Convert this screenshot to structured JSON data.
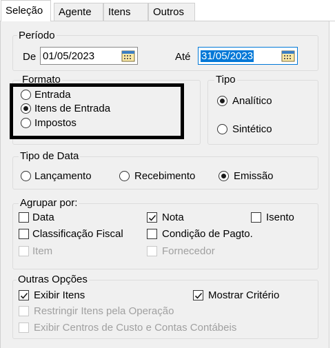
{
  "tabs": [
    "Seleção",
    "Agente",
    "Itens",
    "Outros"
  ],
  "periodo": {
    "legend": "Período",
    "de_label": "De",
    "de_value": "01/05/2023",
    "ate_label": "Até",
    "ate_value": "31/05/2023"
  },
  "formato": {
    "legend": "Formato",
    "options": [
      "Entrada",
      "Itens de Entrada",
      "Impostos"
    ],
    "selected": "Itens de Entrada"
  },
  "tipo": {
    "legend": "Tipo",
    "options": [
      "Analítico",
      "Sintético"
    ],
    "selected": "Analítico"
  },
  "tipo_data": {
    "legend": "Tipo de Data",
    "options": [
      "Lançamento",
      "Recebimento",
      "Emissão"
    ],
    "selected": "Emissão"
  },
  "agrupar": {
    "legend": "Agrupar por:",
    "items": [
      {
        "label": "Data",
        "checked": false,
        "enabled": true
      },
      {
        "label": "Nota",
        "checked": true,
        "enabled": true
      },
      {
        "label": "Isento",
        "checked": false,
        "enabled": true
      },
      {
        "label": "Classificação Fiscal",
        "checked": false,
        "enabled": true
      },
      {
        "label": "Condição de Pagto.",
        "checked": false,
        "enabled": true
      },
      {
        "label": "Item",
        "checked": false,
        "enabled": false
      },
      {
        "label": "Fornecedor",
        "checked": false,
        "enabled": false
      }
    ]
  },
  "outras": {
    "legend": "Outras Opções",
    "items": [
      {
        "label": "Exibir Itens",
        "checked": true,
        "enabled": true
      },
      {
        "label": "Mostrar Critério",
        "checked": true,
        "enabled": true
      },
      {
        "label": "Restringir Itens pela Operação",
        "checked": false,
        "enabled": false
      },
      {
        "label": "Exibir Centros de Custo e Contas Contábeis",
        "checked": false,
        "enabled": false
      }
    ]
  },
  "colors": {
    "selection": "#0078d7",
    "panel": "#f0f0f0",
    "disabled_text": "#a0a0a0"
  }
}
